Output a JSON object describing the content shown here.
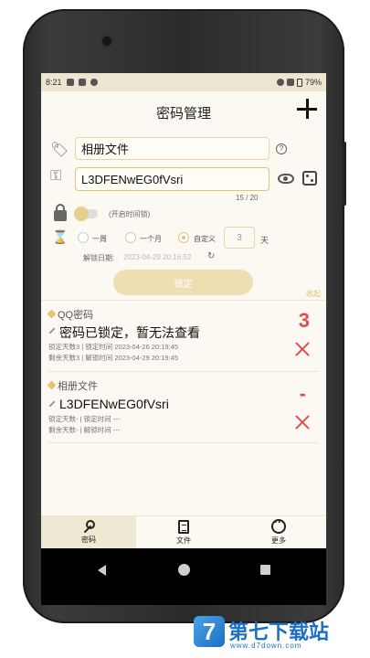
{
  "status_bar": {
    "time": "8:21",
    "battery": "79%"
  },
  "header": {
    "title": "密码管理"
  },
  "form": {
    "name_value": "相册文件",
    "password_value": "L3DFENwEG0fVsri",
    "char_count": "15 / 20",
    "timelock_label": "(开启时间锁)",
    "period_options": [
      "一周",
      "一个月",
      "自定义"
    ],
    "days_value": "3",
    "days_unit": "天",
    "unlock_date_label": "解锁日期:",
    "unlock_date_value": "2023-04-29 20:16:52",
    "lock_button": "锁定",
    "collapse_link": "收起"
  },
  "entries": [
    {
      "category": "QQ密码",
      "password": "密码已锁定，暂无法查看",
      "countdown": "3",
      "locked_line": "锁定天数3 | 锁定时间 2023-04-26 20:19:45",
      "remaining_line": "剩余天数3 | 解锁时间 2023-04-29 20:19:45"
    },
    {
      "category": "相册文件",
      "password": "L3DFENwEG0fVsri",
      "countdown": "-",
      "locked_line": "锁定天数- | 锁定时间 ---",
      "remaining_line": "剩余天数- | 解锁时间 ---"
    }
  ],
  "tabs": [
    {
      "label": "密码",
      "icon": "key-icon"
    },
    {
      "label": "文件",
      "icon": "document-icon"
    },
    {
      "label": "更多",
      "icon": "more-icon"
    }
  ],
  "watermark": {
    "logo_text": "7",
    "title": "第七下载站",
    "url": "www.d7down.com"
  },
  "colors": {
    "accent": "#e3c473",
    "danger": "#e05050",
    "background": "#fbf9f2"
  }
}
